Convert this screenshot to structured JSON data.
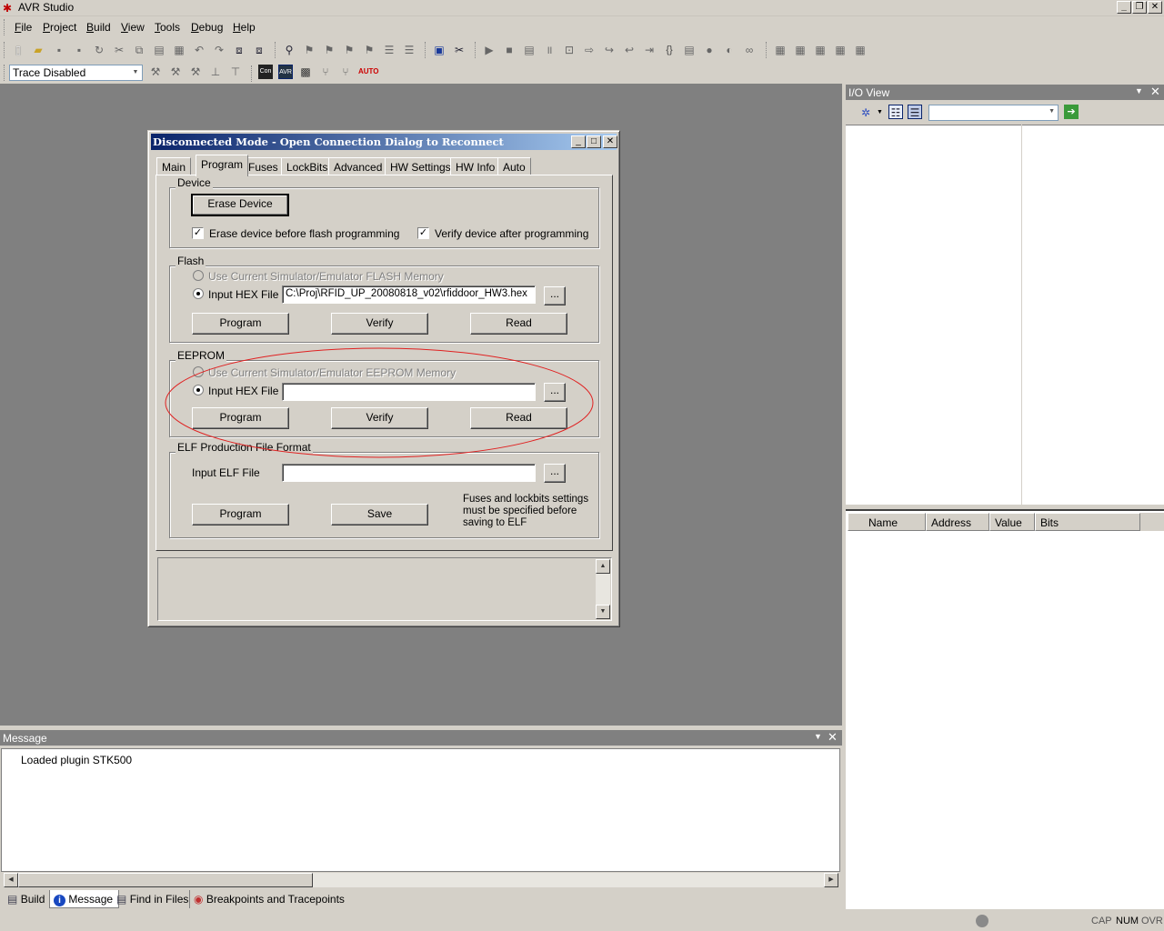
{
  "app": {
    "title": "AVR Studio"
  },
  "menu": [
    "File",
    "Project",
    "Build",
    "View",
    "Tools",
    "Debug",
    "Help"
  ],
  "menu_mnemonics": [
    "F",
    "P",
    "B",
    "V",
    "T",
    "D",
    "H"
  ],
  "trace": {
    "value": "Trace Disabled"
  },
  "dialog": {
    "title": "Disconnected Mode - Open Connection Dialog to Reconnect",
    "tabs": [
      "Main",
      "Program",
      "Fuses",
      "LockBits",
      "Advanced",
      "HW Settings",
      "HW Info",
      "Auto"
    ],
    "active_tab": "Program",
    "device": {
      "label": "Device",
      "erase_button": "Erase Device",
      "erase_before_flash": "Erase device before flash programming",
      "verify_after": "Verify device after programming"
    },
    "flash": {
      "label": "Flash",
      "use_sim": "Use Current Simulator/Emulator FLASH Memory",
      "input_hex": "Input HEX File",
      "hex_path": "C:\\Proj\\RFID_UP_20080818_v02\\rfiddoor_HW3.hex",
      "browse": "...",
      "program": "Program",
      "verify": "Verify",
      "read": "Read"
    },
    "eeprom": {
      "label": "EEPROM",
      "use_sim": "Use Current Simulator/Emulator EEPROM Memory",
      "input_hex": "Input HEX File",
      "hex_path": "",
      "browse": "...",
      "program": "Program",
      "verify": "Verify",
      "read": "Read"
    },
    "elf": {
      "label": "ELF Production File Format",
      "input_elf": "Input ELF File",
      "elf_path": "",
      "browse": "...",
      "program": "Program",
      "save": "Save",
      "note_lines": [
        "Fuses and lockbits settings",
        "must be specified before",
        "saving to ELF"
      ]
    }
  },
  "io_view": {
    "title": "I/O View",
    "columns": [
      "Name",
      "Address",
      "Value",
      "Bits"
    ]
  },
  "message": {
    "title": "Message",
    "lines": [
      "Loaded plugin STK500"
    ]
  },
  "bottom_tabs": [
    "Build",
    "Message",
    "Find in Files",
    "Breakpoints and Tracepoints"
  ],
  "active_bottom_tab": "Message",
  "status": {
    "cap": "CAP",
    "num": "NUM",
    "ovr": "OVR"
  },
  "annotation_color": "#e02020"
}
